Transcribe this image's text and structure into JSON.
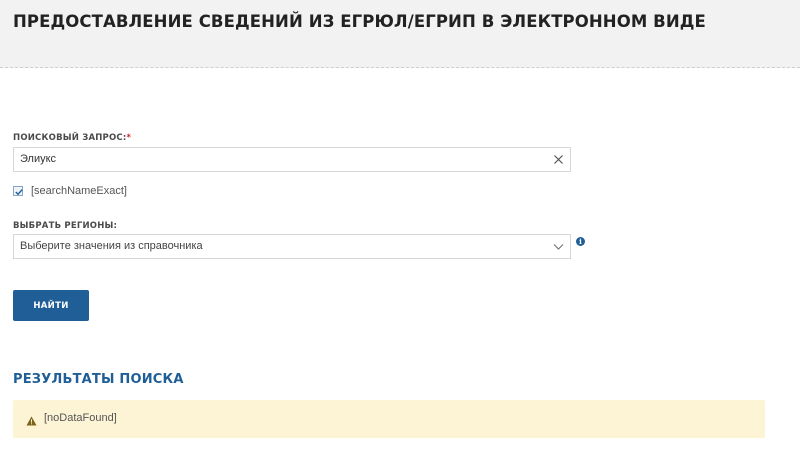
{
  "header": {
    "title": "ПРЕДОСТАВЛЕНИЕ СВЕДЕНИЙ ИЗ ЕГРЮЛ/ЕГРИП В ЭЛЕКТРОННОМ ВИДЕ"
  },
  "search": {
    "label": "ПОИСКОВЫЙ ЗАПРОС:",
    "required_mark": "*",
    "value": "Элиукс",
    "clear_icon": "close-icon"
  },
  "exact_checkbox": {
    "checked": true,
    "label": "[searchNameExact]"
  },
  "regions": {
    "label": "ВЫБРАТЬ РЕГИОНЫ:",
    "placeholder": "Выберите значения из справочника",
    "dropdown_icon": "chevron-down-icon",
    "info_icon": "info-icon"
  },
  "actions": {
    "find_label": "НАЙТИ"
  },
  "results": {
    "title": "РЕЗУЛЬТАТЫ ПОИСКА",
    "message": "[noDataFound]",
    "message_icon": "warning-icon"
  },
  "colors": {
    "accent": "#1f5e97",
    "header_bg": "#f2f2f2",
    "alert_bg": "#fdf3d5",
    "required": "#c62828"
  }
}
